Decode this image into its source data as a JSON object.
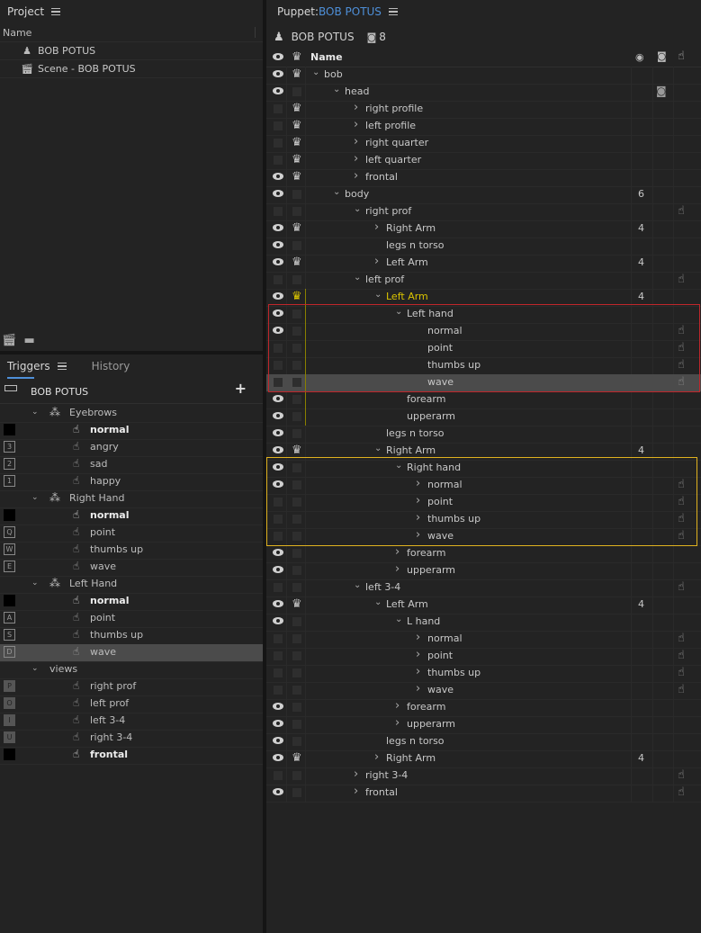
{
  "project": {
    "title": "Project",
    "column_name": "Name",
    "items": [
      {
        "icon": "puppet-icon",
        "label": "BOB POTUS"
      },
      {
        "icon": "scene-icon",
        "label": "Scene - BOB POTUS"
      }
    ]
  },
  "triggers_panel": {
    "tab_triggers": "Triggers",
    "tab_history": "History",
    "puppet_name": "BOB POTUS",
    "rows": [
      {
        "type": "group",
        "label": "Eyebrows"
      },
      {
        "type": "trigger",
        "key": "",
        "keystyle": "black",
        "label": "normal",
        "bold": true
      },
      {
        "type": "trigger",
        "key": "3",
        "keystyle": "outline",
        "label": "angry",
        "bold": false
      },
      {
        "type": "trigger",
        "key": "2",
        "keystyle": "outline",
        "label": "sad",
        "bold": false
      },
      {
        "type": "trigger",
        "key": "1",
        "keystyle": "outline",
        "label": "happy",
        "bold": false
      },
      {
        "type": "group",
        "label": "Right Hand"
      },
      {
        "type": "trigger",
        "key": "",
        "keystyle": "black",
        "label": "normal",
        "bold": true
      },
      {
        "type": "trigger",
        "key": "Q",
        "keystyle": "outline",
        "label": "point",
        "bold": false
      },
      {
        "type": "trigger",
        "key": "W",
        "keystyle": "outline",
        "label": "thumbs up",
        "bold": false
      },
      {
        "type": "trigger",
        "key": "E",
        "keystyle": "outline",
        "label": "wave",
        "bold": false
      },
      {
        "type": "group",
        "label": "Left Hand"
      },
      {
        "type": "trigger",
        "key": "",
        "keystyle": "black",
        "label": "normal",
        "bold": true
      },
      {
        "type": "trigger",
        "key": "A",
        "keystyle": "outline",
        "label": "point",
        "bold": false
      },
      {
        "type": "trigger",
        "key": "S",
        "keystyle": "outline",
        "label": "thumbs up",
        "bold": false
      },
      {
        "type": "trigger",
        "key": "D",
        "keystyle": "outline",
        "label": "wave",
        "bold": false,
        "selected": true
      },
      {
        "type": "plain-group",
        "label": "views"
      },
      {
        "type": "trigger",
        "key": "P",
        "keystyle": "filled",
        "label": "right prof",
        "bold": false
      },
      {
        "type": "trigger",
        "key": "O",
        "keystyle": "filled",
        "label": "left prof",
        "bold": false
      },
      {
        "type": "trigger",
        "key": "I",
        "keystyle": "filled",
        "label": "left 3-4",
        "bold": false
      },
      {
        "type": "trigger",
        "key": "U",
        "keystyle": "filled",
        "label": "right 3-4",
        "bold": false
      },
      {
        "type": "trigger",
        "key": "",
        "keystyle": "black",
        "label": "frontal",
        "bold": true
      }
    ]
  },
  "puppet_panel": {
    "title_prefix": "Puppet: ",
    "title_name": "BOB POTUS",
    "puppet_name": "BOB POTUS",
    "camera_count": "8",
    "column_name": "Name",
    "accent_color": "#4e8fd8",
    "highlight_color": "#d9c300",
    "rows": [
      {
        "eye": true,
        "crown": true,
        "chev": "down",
        "label": "bob"
      },
      {
        "eye": true,
        "crown": false,
        "chev": "down",
        "label": "head",
        "camera": true
      },
      {
        "eye": false,
        "crown": true,
        "chev": "right",
        "label": "right profile"
      },
      {
        "eye": false,
        "crown": true,
        "chev": "right",
        "label": "left profile"
      },
      {
        "eye": false,
        "crown": true,
        "chev": "right",
        "label": "right quarter"
      },
      {
        "eye": false,
        "crown": true,
        "chev": "right",
        "label": "left quarter"
      },
      {
        "eye": true,
        "crown": true,
        "chev": "right",
        "label": "frontal"
      },
      {
        "eye": true,
        "crown": false,
        "chev": "down",
        "label": "body",
        "val": "6"
      },
      {
        "eye": false,
        "crown": false,
        "chev": "down",
        "label": "right prof",
        "hand": true
      },
      {
        "eye": true,
        "crown": true,
        "chev": "right",
        "label": "Right Arm",
        "val": "4"
      },
      {
        "eye": true,
        "crown": false,
        "chev": "",
        "label": "legs n torso"
      },
      {
        "eye": true,
        "crown": true,
        "chev": "right",
        "label": "Left Arm",
        "val": "4"
      },
      {
        "eye": false,
        "crown": false,
        "chev": "down",
        "label": "left prof",
        "hand": true
      },
      {
        "eye": true,
        "crown": true,
        "crownYellow": true,
        "chev": "down",
        "label": "Left Arm",
        "val": "4",
        "yellow": true
      },
      {
        "eye": true,
        "crown": false,
        "chev": "down",
        "label": "Left hand"
      },
      {
        "eye": true,
        "crown": false,
        "chev": "",
        "label": "normal",
        "hand": true
      },
      {
        "eye": false,
        "crown": false,
        "chev": "",
        "label": "point",
        "hand": true
      },
      {
        "eye": false,
        "crown": false,
        "chev": "",
        "label": "thumbs up",
        "hand": true
      },
      {
        "eye": false,
        "crown": false,
        "chev": "",
        "label": "wave",
        "hand": true,
        "selected": true
      },
      {
        "eye": true,
        "crown": false,
        "chev": "",
        "label": "forearm"
      },
      {
        "eye": true,
        "crown": false,
        "chev": "",
        "label": "upperarm"
      },
      {
        "eye": true,
        "crown": false,
        "chev": "",
        "label": "legs n torso"
      },
      {
        "eye": true,
        "crown": true,
        "chev": "down",
        "label": "Right Arm",
        "val": "4"
      },
      {
        "eye": true,
        "crown": false,
        "chev": "down",
        "label": "Right  hand"
      },
      {
        "eye": true,
        "crown": false,
        "chev": "right",
        "label": "normal",
        "hand": true
      },
      {
        "eye": false,
        "crown": false,
        "chev": "right",
        "label": "point",
        "hand": true
      },
      {
        "eye": false,
        "crown": false,
        "chev": "right",
        "label": "thumbs up",
        "hand": true
      },
      {
        "eye": false,
        "crown": false,
        "chev": "right",
        "label": "wave",
        "hand": true
      },
      {
        "eye": true,
        "crown": false,
        "chev": "right",
        "label": "forearm"
      },
      {
        "eye": true,
        "crown": false,
        "chev": "right",
        "label": "upperarm"
      },
      {
        "eye": false,
        "crown": false,
        "chev": "down",
        "label": "left 3-4",
        "hand": true
      },
      {
        "eye": true,
        "crown": true,
        "chev": "down",
        "label": "Left Arm",
        "val": "4"
      },
      {
        "eye": true,
        "crown": false,
        "chev": "down",
        "label": "L hand"
      },
      {
        "eye": false,
        "crown": false,
        "chev": "right",
        "label": "normal",
        "hand": true
      },
      {
        "eye": false,
        "crown": false,
        "chev": "right",
        "label": "point",
        "hand": true
      },
      {
        "eye": false,
        "crown": false,
        "chev": "right",
        "label": "thumbs up",
        "hand": true
      },
      {
        "eye": false,
        "crown": false,
        "chev": "right",
        "label": "wave",
        "hand": true
      },
      {
        "eye": true,
        "crown": false,
        "chev": "right",
        "label": "forearm"
      },
      {
        "eye": true,
        "crown": false,
        "chev": "right",
        "label": "upperarm"
      },
      {
        "eye": true,
        "crown": false,
        "chev": "",
        "label": "legs n torso"
      },
      {
        "eye": true,
        "crown": true,
        "chev": "right",
        "label": "Right Arm",
        "val": "4"
      },
      {
        "eye": false,
        "crown": false,
        "chev": "right",
        "label": "right 3-4",
        "hand": true
      },
      {
        "eye": true,
        "crown": false,
        "chev": "right",
        "label": "frontal",
        "hand": true
      }
    ]
  }
}
